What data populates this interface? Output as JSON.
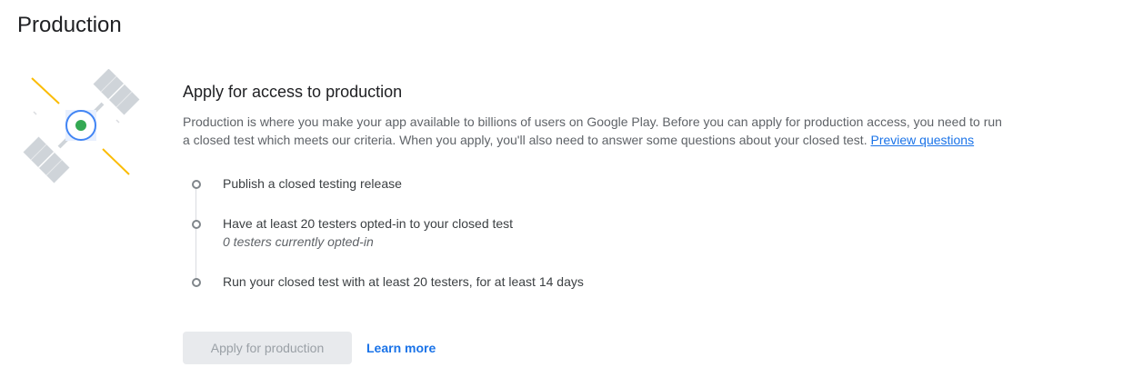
{
  "page": {
    "title": "Production"
  },
  "card": {
    "title": "Apply for access to production",
    "description": "Production is where you make your app available to billions of users on Google Play. Before you can apply for production access, you need to run a closed test which meets our criteria. When you apply, you'll also need to answer some questions about your closed test.",
    "preview_link": "Preview questions",
    "illustration_icon": "satellite-icon"
  },
  "steps": [
    {
      "label": "Publish a closed testing release",
      "detail": ""
    },
    {
      "label": "Have at least 20 testers opted-in to your closed test",
      "detail": "0 testers currently opted-in"
    },
    {
      "label": "Run your closed test with at least 20 testers, for at least 14 days",
      "detail": ""
    }
  ],
  "actions": {
    "apply_label": "Apply for production",
    "learn_more_label": "Learn more"
  },
  "colors": {
    "link": "#1a73e8",
    "satellite_body": "#cfd4d9",
    "satellite_core": "#34a853",
    "satellite_ring": "#4285f4",
    "accent_lines": "#fbbc04"
  }
}
